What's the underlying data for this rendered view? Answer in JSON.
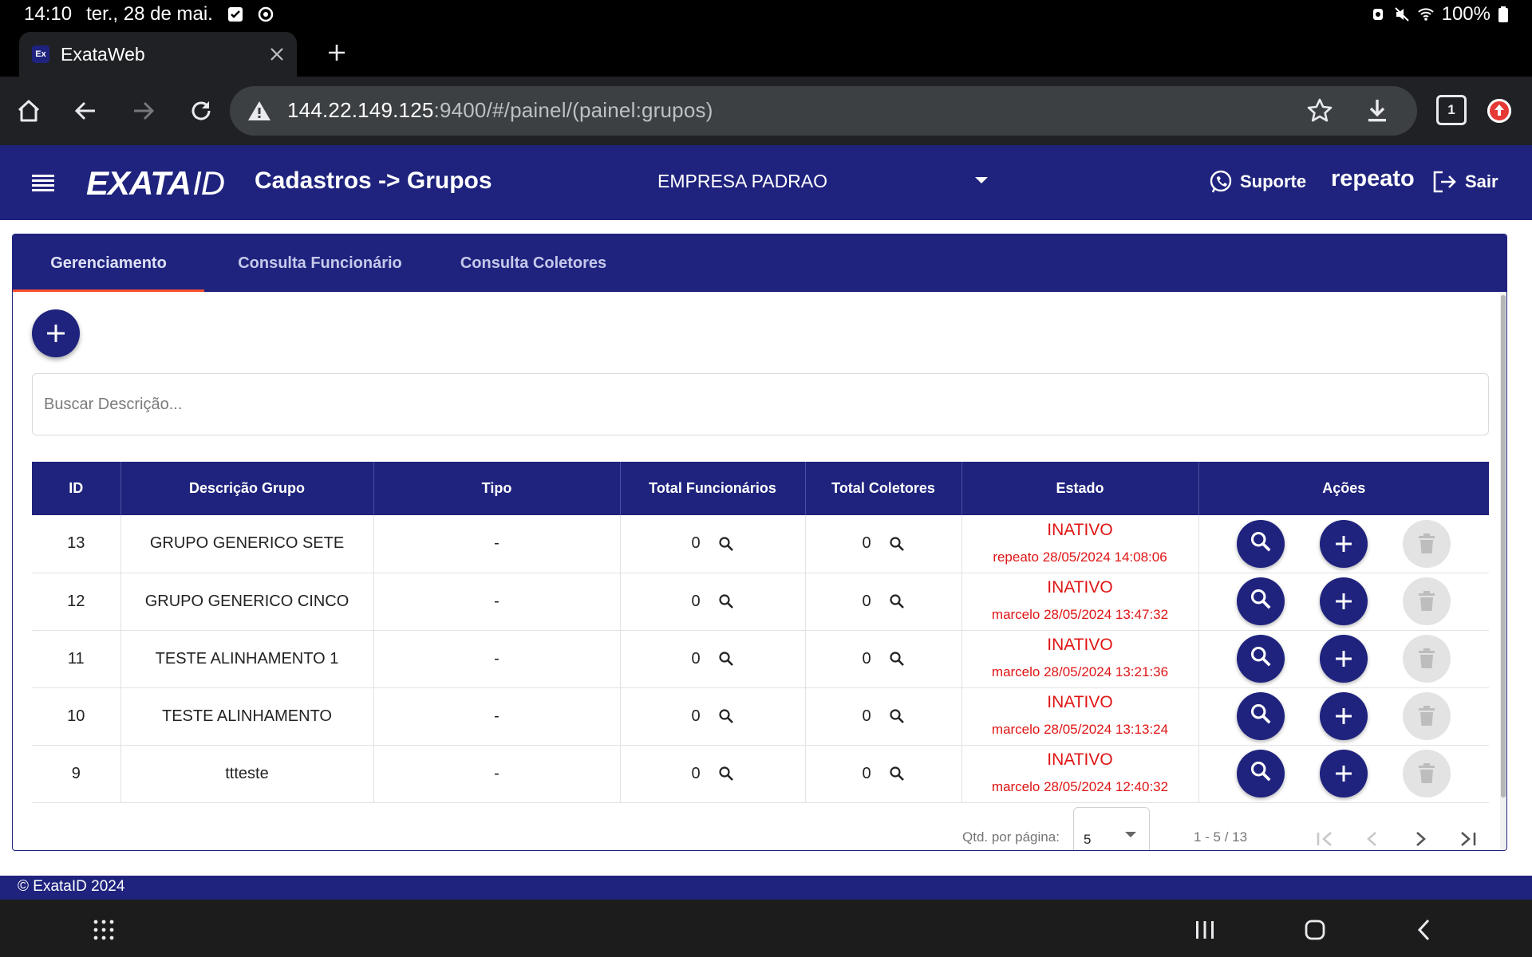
{
  "status_bar": {
    "time": "14:10",
    "date": "ter., 28 de mai.",
    "battery": "100%"
  },
  "browser": {
    "tab_title": "ExataWeb",
    "favicon_text": "Ex",
    "url_host": "144.22.149.125",
    "url_rest": ":9400/#/painel/(painel:grupos)",
    "tab_count": "1"
  },
  "header": {
    "logo_main": "EXATA",
    "logo_id": "ID",
    "page_title": "Cadastros -> Grupos",
    "company": "EMPRESA PADRAO",
    "support_label": "Suporte",
    "user_name": "repeato",
    "logout_label": "Sair"
  },
  "tabs": [
    "Gerenciamento",
    "Consulta Funcionário",
    "Consulta Coletores"
  ],
  "search": {
    "placeholder": "Buscar Descrição..."
  },
  "table": {
    "columns": [
      "ID",
      "Descrição Grupo",
      "Tipo",
      "Total Funcionários",
      "Total Coletores",
      "Estado",
      "Ações"
    ],
    "rows": [
      {
        "id": "13",
        "descricao": "GRUPO GENERICO SETE",
        "tipo": "-",
        "funcionarios": "0",
        "coletores": "0",
        "estado": "INATIVO",
        "estado_info": "repeato 28/05/2024 14:08:06"
      },
      {
        "id": "12",
        "descricao": "GRUPO GENERICO CINCO",
        "tipo": "-",
        "funcionarios": "0",
        "coletores": "0",
        "estado": "INATIVO",
        "estado_info": "marcelo 28/05/2024 13:47:32"
      },
      {
        "id": "11",
        "descricao": "TESTE ALINHAMENTO 1",
        "tipo": "-",
        "funcionarios": "0",
        "coletores": "0",
        "estado": "INATIVO",
        "estado_info": "marcelo 28/05/2024 13:21:36"
      },
      {
        "id": "10",
        "descricao": "TESTE ALINHAMENTO",
        "tipo": "-",
        "funcionarios": "0",
        "coletores": "0",
        "estado": "INATIVO",
        "estado_info": "marcelo 28/05/2024 13:13:24"
      },
      {
        "id": "9",
        "descricao": "ttteste",
        "tipo": "-",
        "funcionarios": "0",
        "coletores": "0",
        "estado": "INATIVO",
        "estado_info": "marcelo 28/05/2024 12:40:32"
      }
    ]
  },
  "paginator": {
    "per_page_label": "Qtd. por página:",
    "per_page_value": "5",
    "range": "1 - 5 / 13"
  },
  "footer": {
    "text": "© ExataID 2024"
  },
  "colors": {
    "brand": "#1f237e",
    "status_inactive": "#e01414",
    "tab_indicator": "#ff4f2e"
  },
  "icons": [
    "home-icon",
    "back-icon",
    "forward-icon",
    "reload-icon",
    "warning-icon",
    "star-icon",
    "download-icon",
    "menu-icon",
    "whatsapp-icon",
    "logout-icon",
    "plus-icon",
    "search-icon",
    "trash-icon",
    "first-page-icon",
    "prev-page-icon",
    "next-page-icon",
    "last-page-icon"
  ]
}
